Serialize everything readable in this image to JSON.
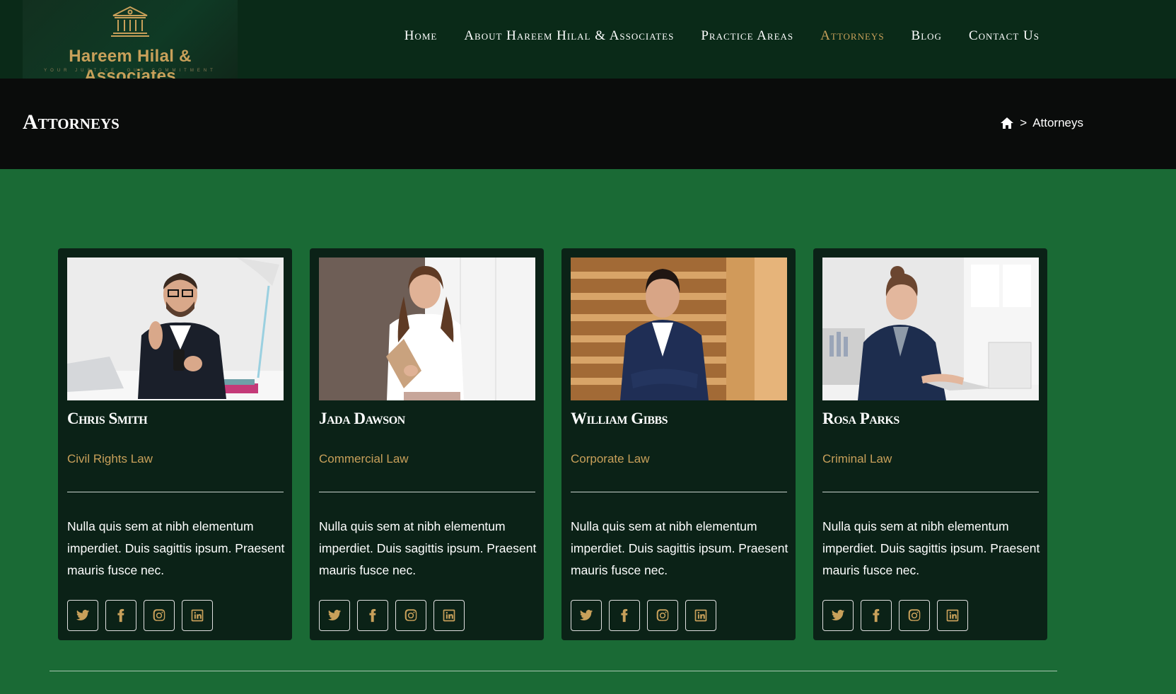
{
  "brand": {
    "name": "Hareem Hilal & Associates",
    "tagline": "YOUR JUSTICE, OUR COMMITMENT"
  },
  "nav": {
    "items": [
      {
        "label": "Home"
      },
      {
        "label": "About Hareem Hilal & Associates"
      },
      {
        "label": "Practice Areas"
      },
      {
        "label": "Attorneys"
      },
      {
        "label": "Blog"
      },
      {
        "label": "Contact Us"
      }
    ],
    "active": "Attorneys"
  },
  "page": {
    "title": "Attorneys",
    "breadcrumb_current": "Attorneys",
    "breadcrumb_separator": ">"
  },
  "attorneys": [
    {
      "name": "Chris Smith",
      "practice": "Civil Rights Law",
      "bio": "Nulla quis sem at nibh elementum imperdiet. Duis sagittis ipsum. Praesent mauris fusce nec."
    },
    {
      "name": "Jada Dawson",
      "practice": "Commercial Law",
      "bio": "Nulla quis sem at nibh elementum imperdiet. Duis sagittis ipsum. Praesent mauris fusce nec."
    },
    {
      "name": "William Gibbs",
      "practice": "Corporate Law",
      "bio": "Nulla quis sem at nibh elementum imperdiet. Duis sagittis ipsum. Praesent mauris fusce nec."
    },
    {
      "name": "Rosa Parks",
      "practice": "Criminal Law",
      "bio": "Nulla quis sem at nibh elementum imperdiet. Duis sagittis ipsum. Praesent mauris fusce nec."
    }
  ],
  "social_icons": [
    "twitter-icon",
    "facebook-icon",
    "instagram-icon",
    "linkedin-icon"
  ],
  "colors": {
    "header_bg": "#0a2a18",
    "titlebar_bg": "#0a0c0b",
    "page_bg": "#1a6a35",
    "card_bg": "#0b2217",
    "accent_gold": "#c8a05a"
  }
}
